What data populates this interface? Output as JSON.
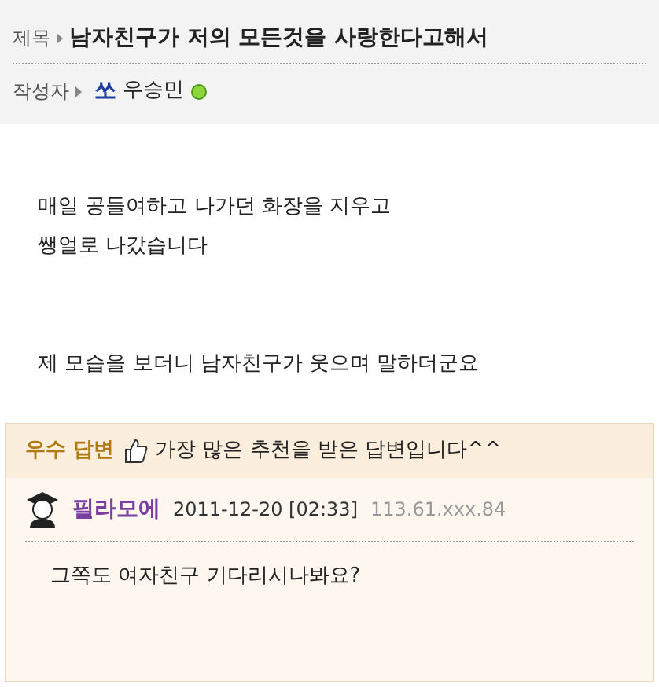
{
  "post": {
    "title_label": "제목",
    "title": "남자친구가 저의 모든것을 사랑한다고해서",
    "author_label": "작성자",
    "author_badge": "쏘",
    "author": "우승민",
    "online": true,
    "body": [
      [
        "매일 공들여하고 나가던 화장을 지우고",
        "쌩얼로 나갔습니다"
      ],
      [
        "제 모습을 보더니 남자친구가 웃으며 말하더군요"
      ]
    ]
  },
  "answer": {
    "badge": "우수 답변",
    "note": "가장 많은 추천을 받은 답변입니다^^",
    "user": "필라모에",
    "date": "2011-12-20 [02:33]",
    "ip": "113.61.xxx.84",
    "text": "그쪽도 여자친구 기다리시나봐요?"
  }
}
